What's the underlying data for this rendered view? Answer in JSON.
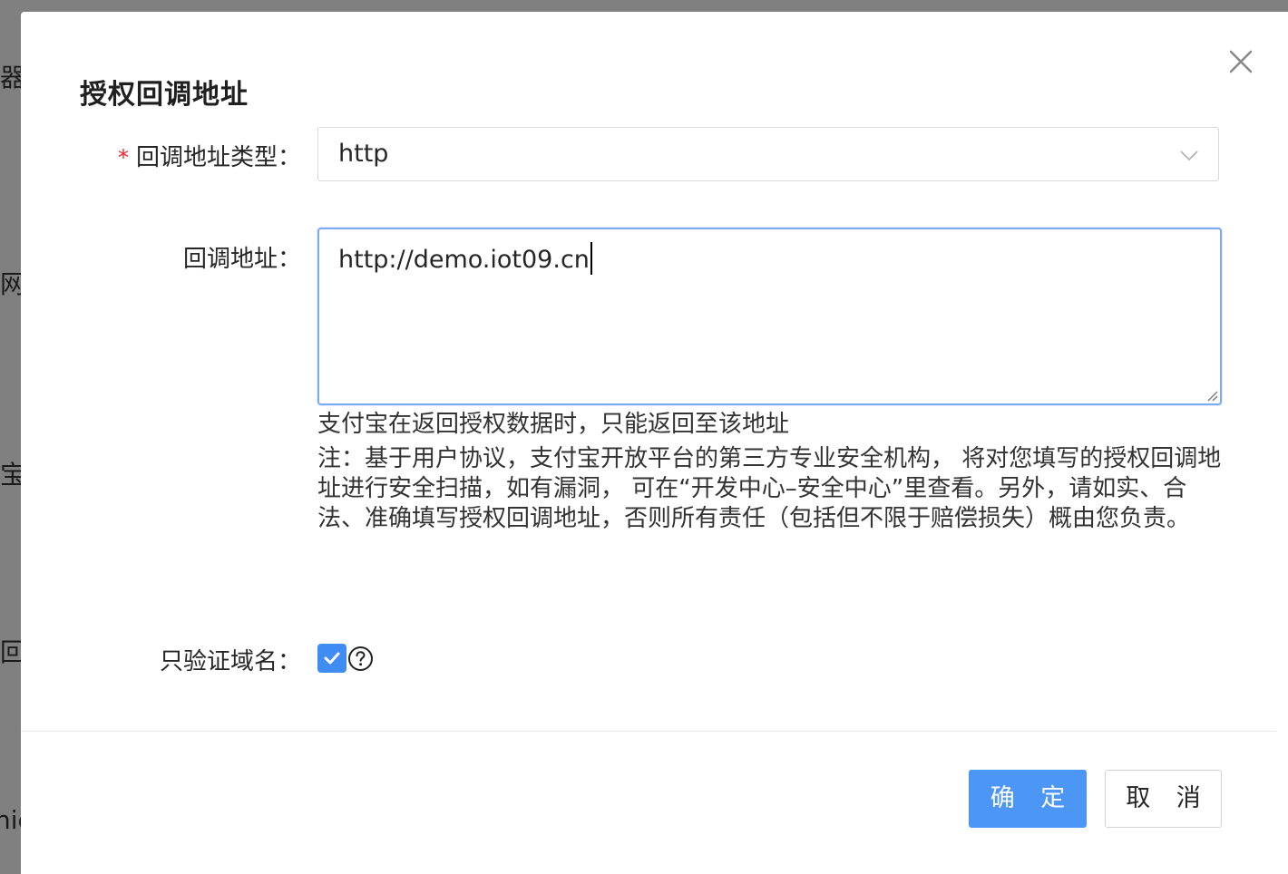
{
  "background": {
    "fragments": [
      "器",
      "网",
      "宝",
      "回",
      "nic"
    ]
  },
  "dialog": {
    "title": "授权回调地址",
    "fields": {
      "callback_type": {
        "label": "回调地址类型：",
        "required_mark": "*",
        "value": "http"
      },
      "callback_url": {
        "label": "回调地址：",
        "value": "http://demo.iot09.cn"
      },
      "verify_domain": {
        "label": "只验证域名：",
        "checked": true
      }
    },
    "help": "支付宝在返回授权数据时，只能返回至该地址",
    "note": "注：基于用户协议，支付宝开放平台的第三方专业安全机构， 将对您填写的授权回调地址进行安全扫描，如有漏洞， 可在“开发中心–安全中心”里查看。另外，请如实、合法、准确填写授权回调地址，否则所有责任（包括但不限于赔偿损失）概由您负责。",
    "buttons": {
      "confirm": "确 定",
      "cancel": "取 消"
    }
  },
  "colors": {
    "primary": "#4c97f5",
    "required": "#f5222d",
    "focus_border": "#7aaaf2",
    "overlay": "#808080"
  },
  "icons": {
    "close": "close-icon",
    "dropdown": "chevron-down-icon",
    "checkbox": "check-icon",
    "help": "question-circle-icon"
  }
}
